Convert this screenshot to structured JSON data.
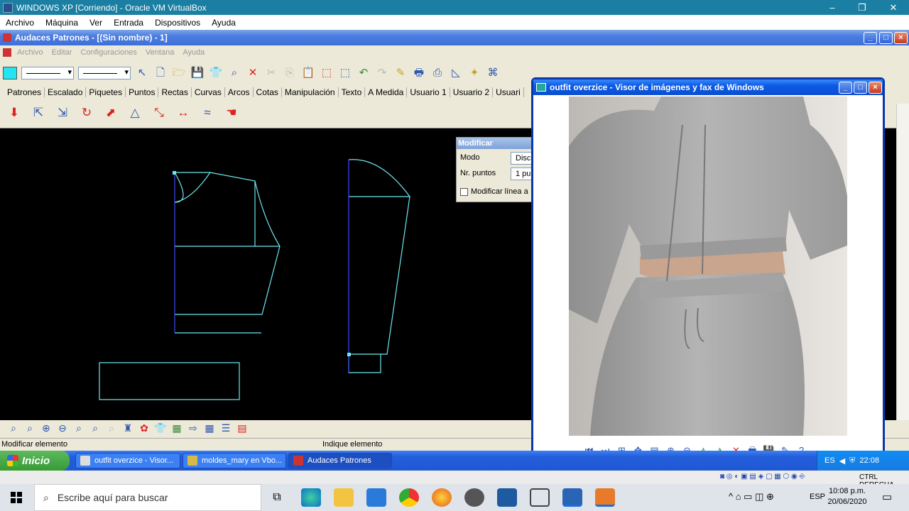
{
  "host": {
    "title": "WINDOWS XP [Corriendo] - Oracle VM VirtualBox",
    "controls": [
      "–",
      "❐",
      "✕"
    ],
    "menu": [
      "Archivo",
      "Máquina",
      "Ver",
      "Entrada",
      "Dispositivos",
      "Ayuda"
    ],
    "status_key": "CTRL DERECHA"
  },
  "audaces": {
    "title": "Audaces Patrones - [(Sin nombre) - 1]",
    "menu": [
      "Archivo",
      "Editar",
      "Configuraciones",
      "Ventana",
      "Ayuda"
    ],
    "tabs": [
      "Patrones",
      "Escalado",
      "Piquetes",
      "Puntos",
      "Rectas",
      "Curvas",
      "Arcos",
      "Cotas",
      "Manipulación",
      "Texto",
      "A Medida",
      "Usuario 1",
      "Usuario 2",
      "Usuari"
    ],
    "active_tab": "Manipulación",
    "color_accent": "#22e5f0",
    "status_left": "Modificar elemento",
    "status_right": "Indique elemento"
  },
  "modificar": {
    "title": "Modificar",
    "modo_label": "Modo",
    "modo_value": "Disc",
    "puntos_label": "Nr. puntos",
    "puntos_value": "1 pu",
    "checkbox_label": "Modificar línea a"
  },
  "viewer": {
    "title": "outfit overzice - Visor de imágenes y fax de Windows"
  },
  "xp_taskbar": {
    "start": "Inicio",
    "tasks": [
      "outfit overzice - Visor...",
      "moldes_mary en Vbo...",
      "Audaces Patrones"
    ],
    "lang": "ES",
    "time": "22:08"
  },
  "win10": {
    "search_placeholder": "Escribe aquí para buscar",
    "lang": "ESP",
    "time": "10:08 p.m.",
    "date": "20/06/2020"
  }
}
